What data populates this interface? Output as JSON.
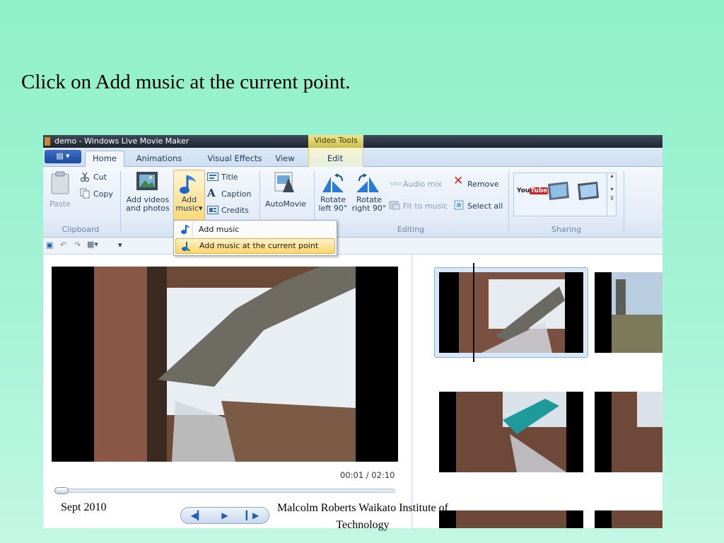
{
  "slide": {
    "title": "Click on Add music at the current point.",
    "footer_date": "Sept 2010",
    "footer_author": "Malcolm Roberts Waikato Institute of Technology"
  },
  "window": {
    "title": "demo - Windows Live Movie Maker",
    "context_tab_group": "Video Tools"
  },
  "tabs": [
    {
      "label": "Home",
      "active": true
    },
    {
      "label": "Animations"
    },
    {
      "label": "Visual Effects"
    },
    {
      "label": "View"
    },
    {
      "label": "Edit"
    }
  ],
  "ribbon": {
    "clipboard": {
      "paste": "Paste",
      "cut": "Cut",
      "copy": "Copy",
      "group_label": "Clipboard"
    },
    "add": {
      "add_videos_line1": "Add videos",
      "add_videos_line2": "and photos",
      "add_music_line1": "Add",
      "add_music_line2": "music",
      "title": "Title",
      "caption": "Caption",
      "credits": "Credits"
    },
    "automovie": "AutoMovie",
    "editing": {
      "rotate_left_line1": "Rotate",
      "rotate_left_line2": "left 90°",
      "rotate_right_line1": "Rotate",
      "rotate_right_line2": "right 90°",
      "audio_mix": "Audio mix",
      "fit_to_music": "Fit to music",
      "remove": "Remove",
      "select_all": "Select all",
      "group_label": "Editing"
    },
    "sharing": {
      "youtube": "YouTube",
      "group_label": "Sharing"
    }
  },
  "add_music_menu": {
    "items": [
      {
        "label": "Add music",
        "icon": "music-note-icon"
      },
      {
        "label": "Add music at the current point",
        "icon": "music-note-plus-icon",
        "highlighted": true
      }
    ]
  },
  "preview": {
    "time": "00:01 / 02:10"
  },
  "colors": {
    "slide_background": "#8ff0c9",
    "ribbon_highlight": "#ffd87a",
    "title_bar": "#1d2531",
    "accent_blue": "#1f5fb8"
  }
}
